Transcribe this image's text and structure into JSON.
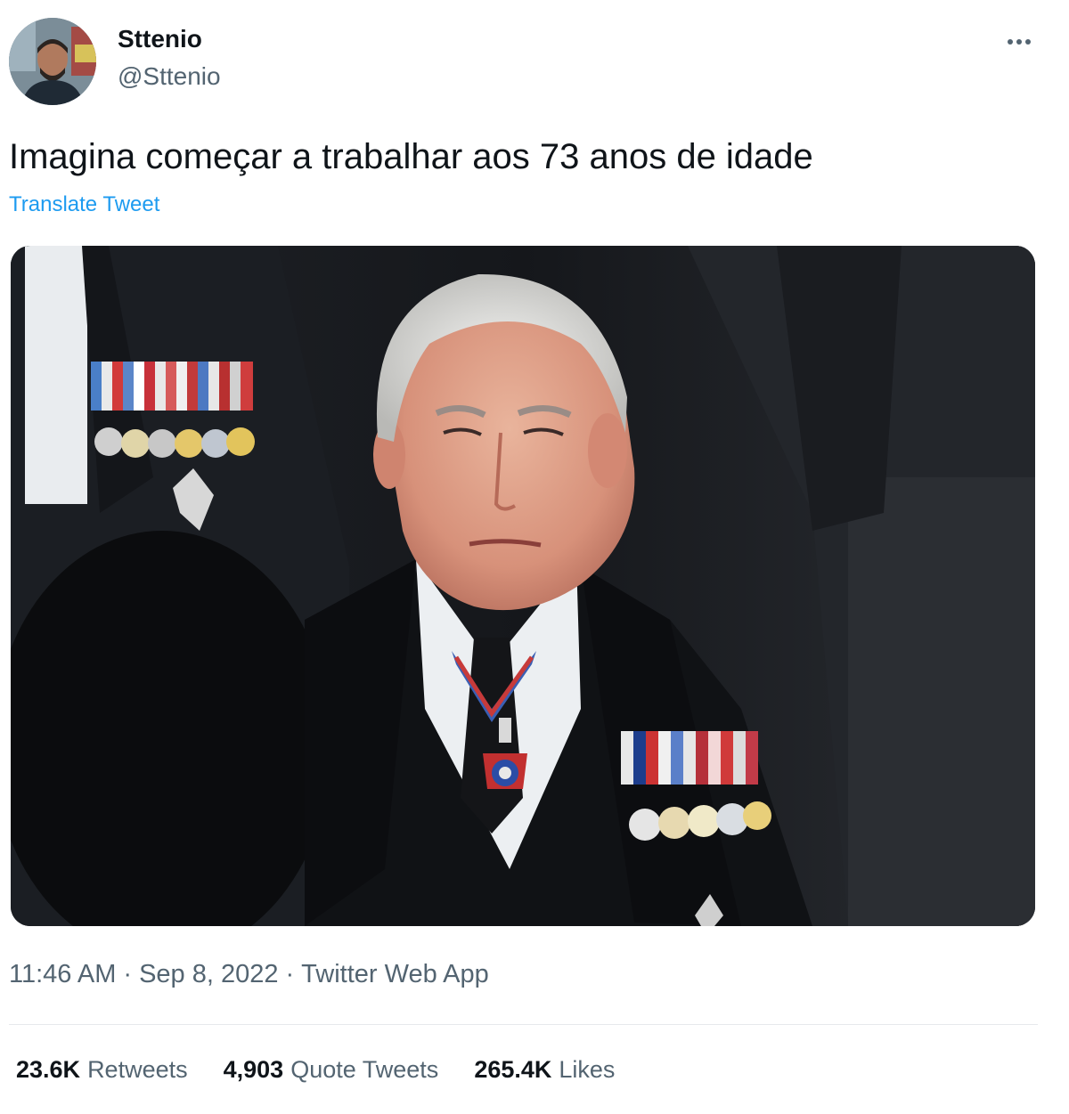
{
  "tweet": {
    "author": {
      "display_name": "Sttenio",
      "handle": "@Sttenio"
    },
    "text": "Imagina começar a trabalhar aos 73 anos de idade",
    "translate_label": "Translate Tweet",
    "time": "11:46 AM",
    "date": "Sep 8, 2022",
    "source": "Twitter Web App",
    "separator": "·",
    "stats": {
      "retweets": {
        "count": "23.6K",
        "label": "Retweets"
      },
      "quote_tweets": {
        "count": "4,903",
        "label": "Quote Tweets"
      },
      "likes": {
        "count": "265.4K",
        "label": "Likes"
      }
    }
  },
  "icons": {
    "more": "more-horizontal-icon"
  },
  "colors": {
    "link": "#1d9bf0",
    "secondary_text": "#536471",
    "primary_text": "#0f1419"
  }
}
